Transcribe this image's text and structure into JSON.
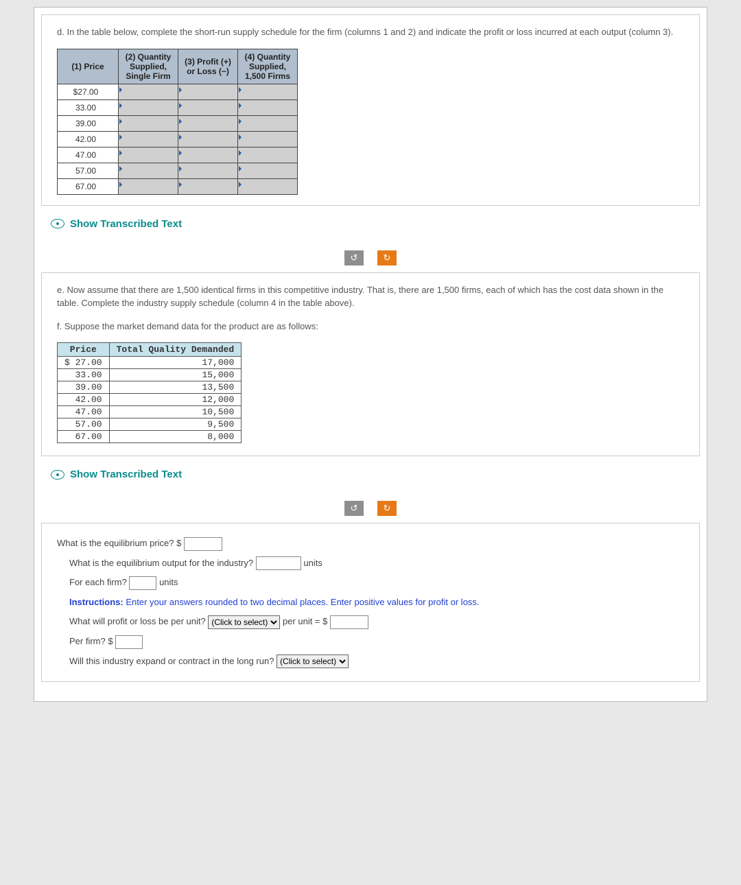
{
  "partD": {
    "prompt": "d. In the table below, complete the short-run supply schedule for the firm (columns 1 and 2) and indicate the profit or loss incurred at each output (column 3).",
    "headers": {
      "c1": "(1) Price",
      "c2": "(2) Quantity Supplied, Single Firm",
      "c3": "(3) Profit (+) or Loss (−)",
      "c4": "(4) Quantity Supplied, 1,500 Firms"
    },
    "prices": [
      "$27.00",
      "33.00",
      "39.00",
      "42.00",
      "47.00",
      "57.00",
      "67.00"
    ]
  },
  "transcribe_label": "Show Transcribed Text",
  "partE": {
    "prompt": "e. Now assume that there are 1,500 identical firms in this competitive industry. That is, there are 1,500 firms, each of which has the cost data shown in the table. Complete the industry supply schedule (column 4 in the table above)."
  },
  "partF": {
    "prompt": "f. Suppose the market demand data for the product are as follows:",
    "headers": {
      "price": "Price",
      "qty": "Total Quality Demanded"
    },
    "rows": [
      {
        "price": "$ 27.00",
        "qty": "17,000"
      },
      {
        "price": "33.00",
        "qty": "15,000"
      },
      {
        "price": "39.00",
        "qty": "13,500"
      },
      {
        "price": "42.00",
        "qty": "12,000"
      },
      {
        "price": "47.00",
        "qty": "10,500"
      },
      {
        "price": "57.00",
        "qty": "9,500"
      },
      {
        "price": "67.00",
        "qty": "8,000"
      }
    ]
  },
  "answers": {
    "q_eq_price": "What is the equilibrium price?  $",
    "q_eq_output": "What is the equilibrium output for the industry?",
    "units": "units",
    "q_each_firm": "For each firm?",
    "instructions_label": "Instructions:",
    "instructions_text": " Enter your answers rounded to two decimal places. Enter positive values for profit or loss.",
    "q_profit_unit": "What will profit or loss be per unit?",
    "per_unit_equals": "per unit = $",
    "q_per_firm": "Per firm?  $",
    "q_expand": "Will this industry expand or contract in the long run?",
    "select_placeholder": "(Click to select)"
  }
}
